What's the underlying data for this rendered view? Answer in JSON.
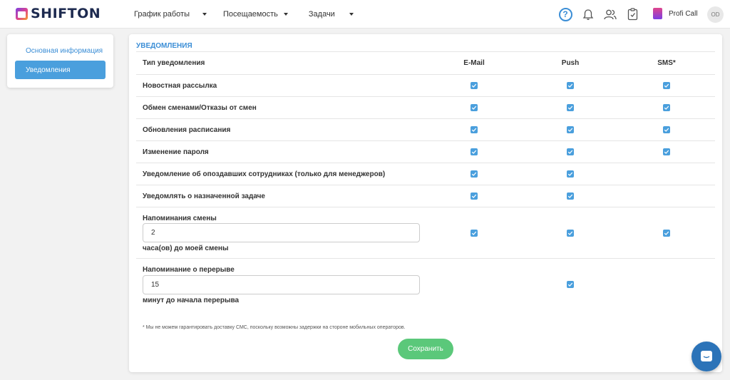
{
  "header": {
    "logo_text": "SHIFTON",
    "nav": [
      {
        "label": "График работы"
      },
      {
        "label": "Посещаемость"
      },
      {
        "label": "Задачи"
      }
    ],
    "help_symbol": "?",
    "company_name": "Profi Call",
    "avatar_initials": "OD",
    "icons": [
      "help-icon",
      "bell-icon",
      "users-icon",
      "clipboard-icon"
    ]
  },
  "sidebar": {
    "items": [
      {
        "label": "Основная информация",
        "active": false
      },
      {
        "label": "Уведомления",
        "active": true
      }
    ]
  },
  "main": {
    "section_title": "УВЕДОМЛЕНИЯ",
    "columns": {
      "type": "Тип уведомления",
      "email": "E-Mail",
      "push": "Push",
      "sms": "SMS*"
    },
    "rows": [
      {
        "name": "Новостная рассылка",
        "email": true,
        "push": true,
        "sms": true
      },
      {
        "name": "Обмен сменами/Отказы от смен",
        "email": true,
        "push": true,
        "sms": true
      },
      {
        "name": "Обновления расписания",
        "email": true,
        "push": true,
        "sms": true
      },
      {
        "name": "Изменение пароля",
        "email": true,
        "push": true,
        "sms": true
      },
      {
        "name": "Уведомление об опоздавших сотрудниках (только для менеджеров)",
        "email": true,
        "push": true,
        "sms": false
      },
      {
        "name": "Уведомлять о назначенной задаче",
        "email": true,
        "push": true,
        "sms": false
      }
    ],
    "shift_reminder": {
      "name": "Напоминания смены",
      "value": "2",
      "suffix": "часа(ов) до моей смены",
      "email": true,
      "push": true,
      "sms": true
    },
    "break_reminder": {
      "name": "Напоминание о перерыве",
      "value": "15",
      "suffix": "минут до начала перерыва",
      "email": false,
      "push": true,
      "sms": false
    },
    "footnote": "* Мы не можем гарантировать доставку СМС, поскольку возможны задержки на стороне мобильных операторов.",
    "save_label": "Сохранить"
  },
  "colors": {
    "accent": "#3b8ed6",
    "checkbox": "#4a9fdd",
    "save": "#5bc87a",
    "chat": "#2b73b8"
  }
}
